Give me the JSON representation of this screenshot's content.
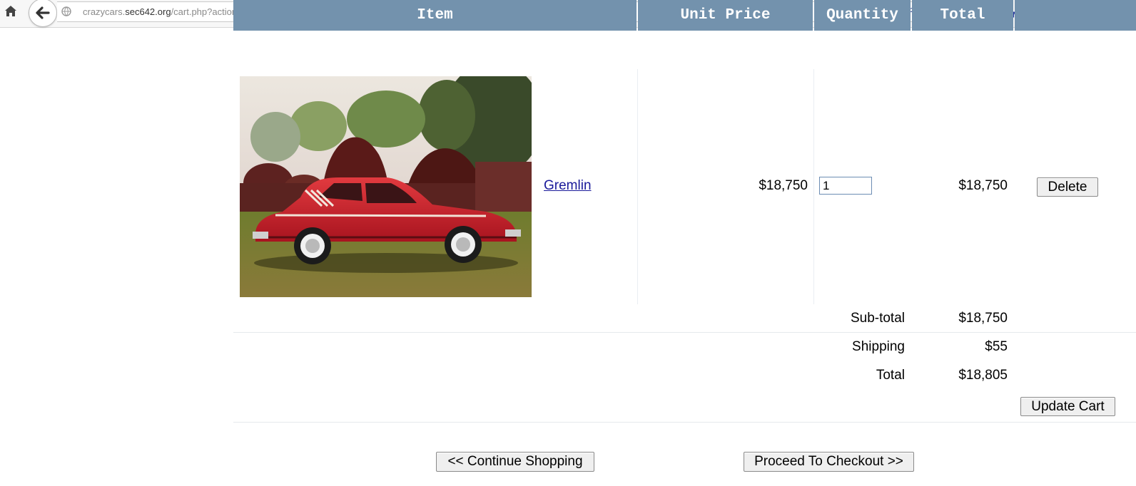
{
  "browser": {
    "url_prefix": "crazycars.",
    "url_domain": "sec642.org",
    "url_path": "/cart.php?action=view",
    "ext_php_label": "php"
  },
  "cart": {
    "columns": [
      "Item",
      "Unit Price",
      "Quantity",
      "Total"
    ],
    "items": [
      {
        "name": "Gremlin",
        "unit_price": "$18,750",
        "quantity": "1",
        "total": "$18,750",
        "delete_label": "Delete",
        "image": "red-car-photo"
      }
    ],
    "subtotal_label": "Sub-total",
    "subtotal_value": "$18,750",
    "shipping_label": "Shipping",
    "shipping_value": "$55",
    "total_label": "Total",
    "total_value": "$18,805",
    "update_label": "Update Cart",
    "continue_label": "<< Continue Shopping",
    "checkout_label": "Proceed To Checkout >>"
  },
  "colors": {
    "header_bg": "#7392ad",
    "header_text": "#ffffff",
    "link": "#1a1a9a"
  }
}
